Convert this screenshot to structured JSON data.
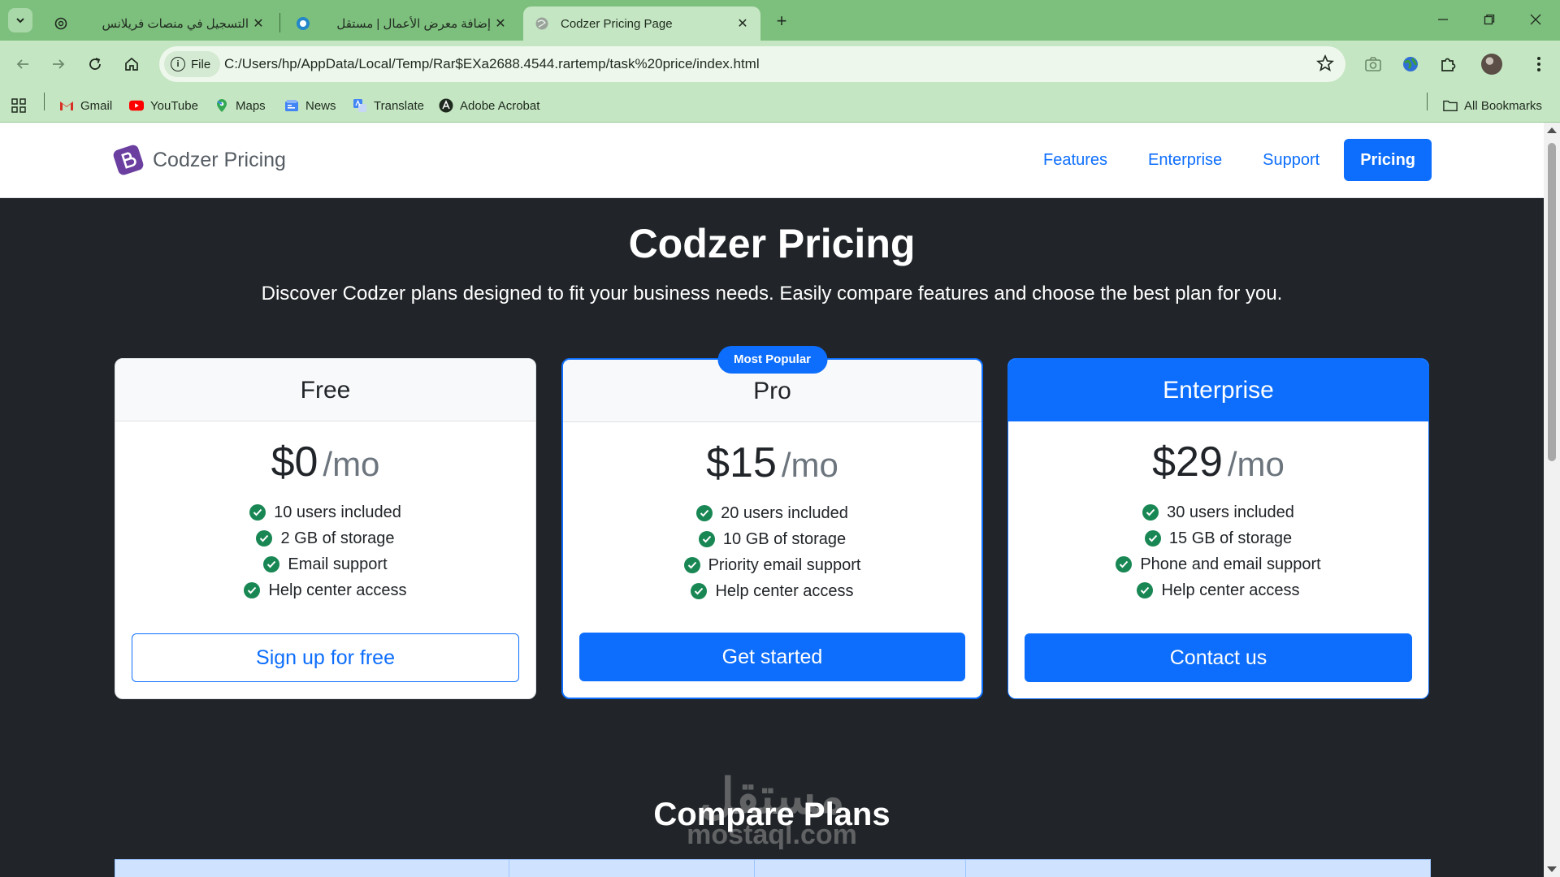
{
  "browser": {
    "tabs": [
      {
        "title": "التسجيل في منصات فريلانس",
        "active": false,
        "rtl": true
      },
      {
        "title": "إضافة معرض الأعمال | مستقل",
        "active": false,
        "rtl": true
      },
      {
        "title": "Codzer Pricing Page",
        "active": true,
        "rtl": false
      }
    ],
    "site_chip": "File",
    "url": "C:/Users/hp/AppData/Local/Temp/Rar$EXa2688.4544.rartemp/task%20price/index.html",
    "bookmarks": [
      {
        "label": "Gmail",
        "icon": "gmail-icon"
      },
      {
        "label": "YouTube",
        "icon": "youtube-icon"
      },
      {
        "label": "Maps",
        "icon": "maps-icon"
      },
      {
        "label": "News",
        "icon": "news-icon"
      },
      {
        "label": "Translate",
        "icon": "translate-icon"
      },
      {
        "label": "Adobe Acrobat",
        "icon": "acrobat-icon"
      }
    ],
    "all_bookmarks": "All Bookmarks"
  },
  "site": {
    "brand": "Codzer Pricing",
    "nav": [
      "Features",
      "Enterprise",
      "Support",
      "Pricing"
    ],
    "active_nav": "Pricing"
  },
  "hero": {
    "title": "Codzer Pricing",
    "lead": "Discover Codzer plans designed to fit your business needs. Easily compare features and choose the best plan for you."
  },
  "plans": [
    {
      "name": "Free",
      "price": "$0",
      "period": "/mo",
      "features": [
        "10 users included",
        "2 GB of storage",
        "Email support",
        "Help center access"
      ],
      "cta": "Sign up for free"
    },
    {
      "name": "Pro",
      "badge": "Most Popular",
      "price": "$15",
      "period": "/mo",
      "features": [
        "20 users included",
        "10 GB of storage",
        "Priority email support",
        "Help center access"
      ],
      "cta": "Get started"
    },
    {
      "name": "Enterprise",
      "price": "$29",
      "period": "/mo",
      "features": [
        "30 users included",
        "15 GB of storage",
        "Phone and email support",
        "Help center access"
      ],
      "cta": "Contact us"
    }
  ],
  "compare": {
    "title": "Compare Plans"
  },
  "watermark": {
    "ar": "مستقل",
    "en": "mostaql.com"
  },
  "colors": {
    "primary": "#0d6efd",
    "success": "#198754",
    "dark": "#212529",
    "chrome_green": "#7dbf7d"
  }
}
